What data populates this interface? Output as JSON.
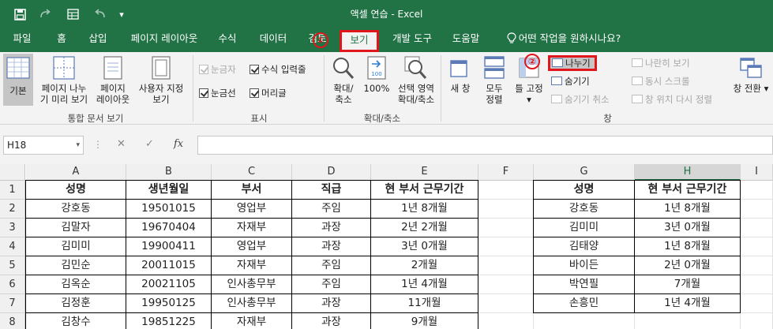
{
  "window": {
    "title": "액셀 연습  -  Excel"
  },
  "quick_access": {
    "more": "▾"
  },
  "tabs": [
    "파일",
    "홈",
    "삽입",
    "페이지 레이아웃",
    "수식",
    "데이터",
    "검토",
    "보기",
    "개발 도구",
    "도움말",
    "어떤 작업을 원하시나요?"
  ],
  "callouts": {
    "one": "①",
    "two": "②"
  },
  "ribbon": {
    "views": {
      "normal": "기본",
      "page_break_1": "페이지 나누",
      "page_break_2": "기 미리 보기",
      "page_layout_1": "페이지",
      "page_layout_2": "레이아웃",
      "custom_1": "사용자 지정",
      "custom_2": "보기",
      "label": "통합 문서 보기"
    },
    "show": {
      "ruler": "눈금자",
      "formula_bar": "수식 입력줄",
      "gridlines": "눈금선",
      "headings": "머리글",
      "label": "표시"
    },
    "zoom": {
      "zoom_1": "확대/",
      "zoom_2": "축소",
      "hundred": "100%",
      "selection_1": "선택 영역",
      "selection_2": "확대/축소",
      "label": "확대/축소"
    },
    "window": {
      "new_window": "새 창",
      "arrange_1": "모두",
      "arrange_2": "정렬",
      "freeze": "틀 고정",
      "split": "나누기",
      "hide": "숨기기",
      "unhide": "숨기기 취소",
      "side_by_side": "나란히 보기",
      "sync_scroll": "동시 스크롤",
      "reset_pos": "창 위치 다시 정렬",
      "switch": "창 전환",
      "label": "창"
    }
  },
  "formula_bar": {
    "name_box": "H18",
    "fx": "fx",
    "cancel": "✕",
    "enter": "✓",
    "value": ""
  },
  "sheet": {
    "columns": [
      "A",
      "B",
      "C",
      "D",
      "E",
      "F",
      "G",
      "H",
      "I"
    ],
    "rows": [
      "1",
      "2",
      "3",
      "4",
      "5",
      "6",
      "7",
      "8"
    ],
    "table1": {
      "headers": [
        "성명",
        "생년월일",
        "부서",
        "직급",
        "현 부서 근무기간"
      ],
      "rows": [
        [
          "강호동",
          "19501015",
          "영업부",
          "주임",
          "1년 8개월"
        ],
        [
          "김말자",
          "19670404",
          "자재부",
          "과장",
          "2년 2개월"
        ],
        [
          "김미미",
          "19900411",
          "영업부",
          "과장",
          "3년 0개월"
        ],
        [
          "김민순",
          "20011015",
          "자재부",
          "주임",
          "2개월"
        ],
        [
          "김옥순",
          "20021105",
          "인사총무부",
          "주임",
          "1년 4개월"
        ],
        [
          "김정훈",
          "19950125",
          "인사총무부",
          "과장",
          "11개월"
        ],
        [
          "김창수",
          "19851225",
          "자재부",
          "과장",
          "9개월"
        ]
      ]
    },
    "table2": {
      "headers": [
        "성명",
        "현 부서 근무기간"
      ],
      "rows": [
        [
          "강호동",
          "1년 8개월"
        ],
        [
          "김미미",
          "3년 0개월"
        ],
        [
          "김태양",
          "1년 8개월"
        ],
        [
          "바이든",
          "2년 0개월"
        ],
        [
          "박연필",
          "7개월"
        ],
        [
          "손흥민",
          "1년 4개월"
        ]
      ]
    }
  },
  "colors": {
    "excel_green": "#217346",
    "highlight_red": "#e0161d"
  }
}
